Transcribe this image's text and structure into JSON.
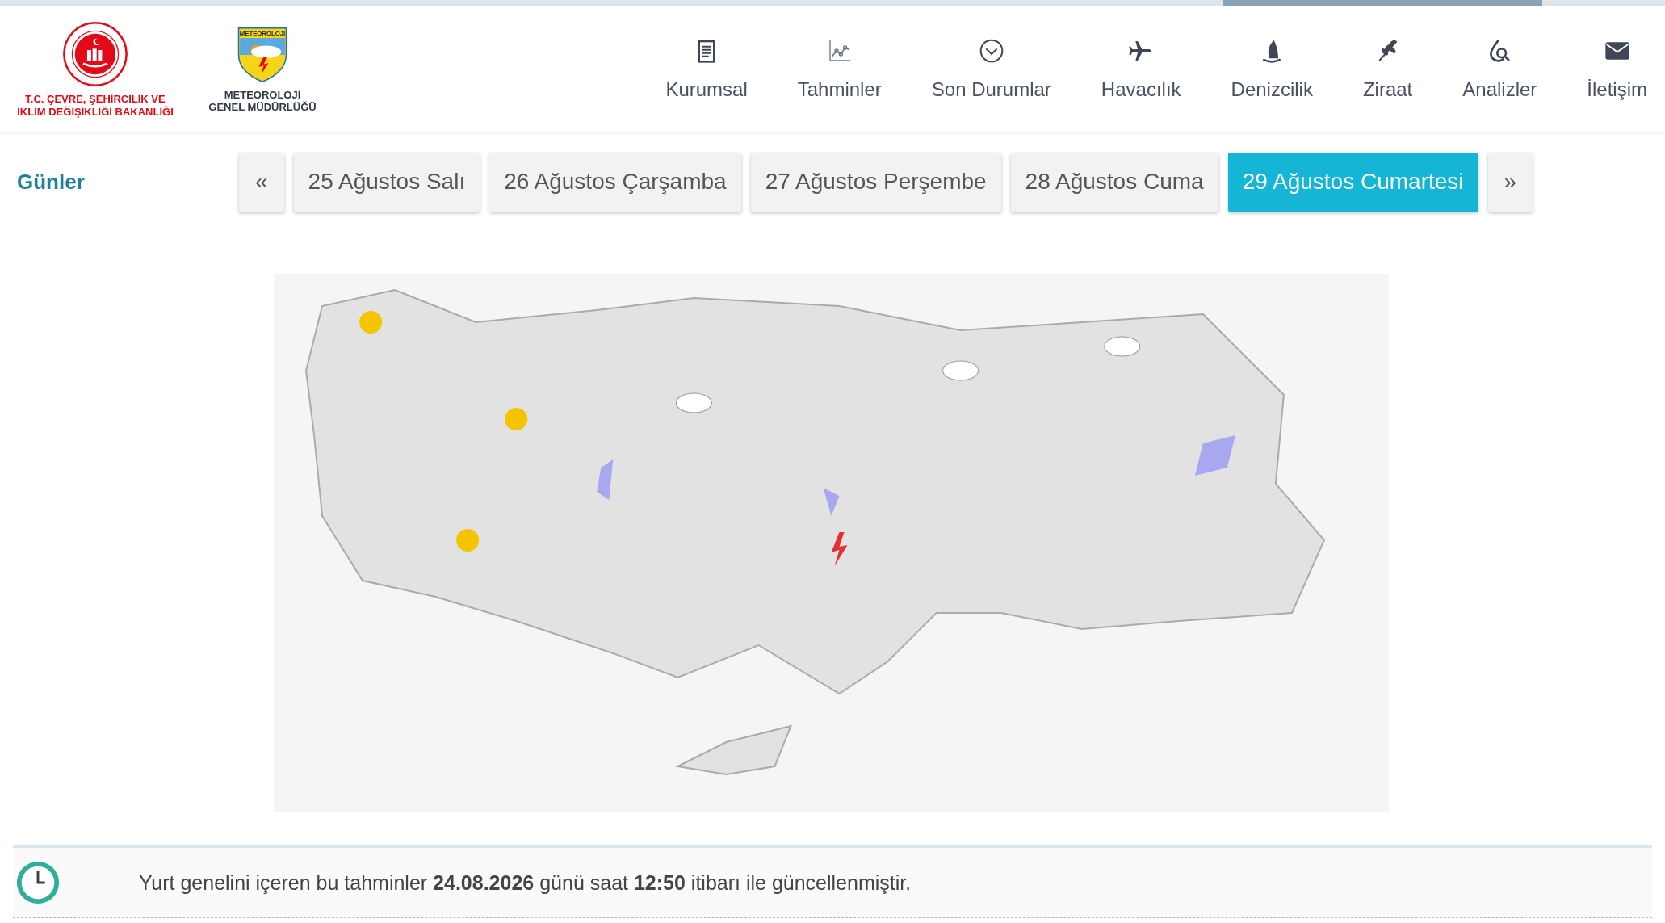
{
  "header": {
    "ministry_logo": {
      "text": "T.C. ÇEVRE, ŞEHİRCİLİK VE İKLİM DEĞİŞİKLİĞİ BAKANLIĞI"
    },
    "agency_logo": {
      "badge": "METEOROLOJİ",
      "text": "METEOROLOJİ GENEL MÜDÜRLÜĞÜ"
    },
    "nav": [
      {
        "label": "Kurumsal"
      },
      {
        "label": "Tahminler"
      },
      {
        "label": "Son Durumlar"
      },
      {
        "label": "Havacılık"
      },
      {
        "label": "Denizcilik"
      },
      {
        "label": "Ziraat"
      },
      {
        "label": "Analizler"
      },
      {
        "label": "İletişim"
      }
    ]
  },
  "days": {
    "title": "Günler",
    "tabs": [
      {
        "kind": "arrow",
        "label": "«",
        "selected": false
      },
      {
        "kind": "day",
        "label": "25 Ağustos Salı",
        "selected": false
      },
      {
        "kind": "day",
        "label": "26 Ağustos Çarşamba",
        "selected": false
      },
      {
        "kind": "day",
        "label": "27 Ağustos Perşembe",
        "selected": false
      },
      {
        "kind": "day",
        "label": "28 Ağustos Cuma",
        "selected": false
      },
      {
        "kind": "day",
        "label": "29 Ağustos Cumartesi",
        "selected": true
      },
      {
        "kind": "arrow",
        "label": "»",
        "selected": false
      }
    ]
  },
  "update_note": {
    "text": "Yurt genelini içeren bu tahminler **24.08.2026** günü saat **12:50** itibarı ile güncellenmiştir."
  }
}
